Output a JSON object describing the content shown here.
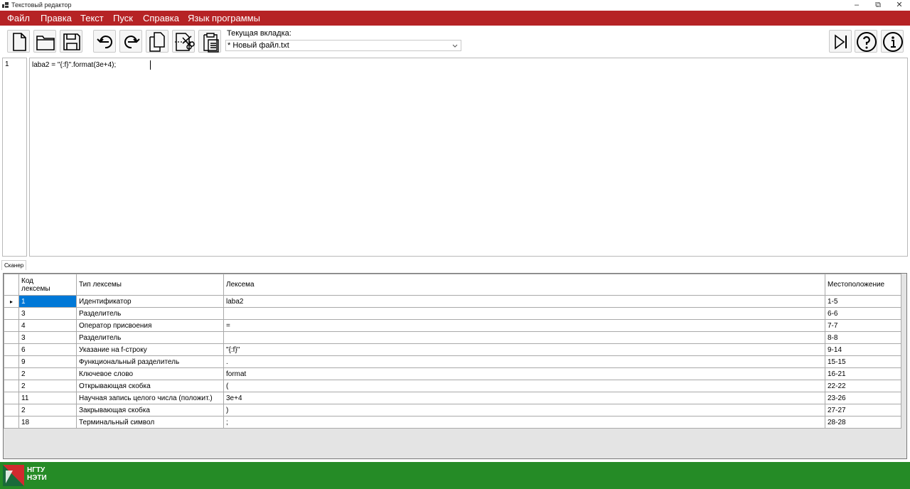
{
  "window": {
    "title": "Текстовый редактор",
    "minimize": "–",
    "restore": "⧉",
    "close": "✕"
  },
  "menu": [
    "Файл",
    "Правка",
    "Текст",
    "Пуск",
    "Справка",
    "Язык программы"
  ],
  "toolbar": {
    "tab_label": "Текущая вкладка:",
    "tab_value": "* Новый файл.txt",
    "buttons": [
      "new-file-icon",
      "open-folder-icon",
      "save-icon",
      "undo-icon",
      "redo-icon",
      "copy-icon",
      "cut-icon",
      "paste-icon",
      "run-icon",
      "help-icon",
      "info-icon"
    ]
  },
  "editor": {
    "line_numbers": "1",
    "code": "laba2 = \"{:f}\".format(3e+4);"
  },
  "scanner": {
    "tab": "Сканер",
    "headers": [
      "Код\nлексемы",
      "Тип лексемы",
      "Лексема",
      "Местоположение"
    ],
    "rows": [
      {
        "code": "1",
        "type": "Идентификатор",
        "lexeme": "laba2",
        "loc": "1-5"
      },
      {
        "code": "3",
        "type": "Разделитель",
        "lexeme": "",
        "loc": "6-6"
      },
      {
        "code": "4",
        "type": "Оператор присвоения",
        "lexeme": "=",
        "loc": "7-7"
      },
      {
        "code": "3",
        "type": "Разделитель",
        "lexeme": "",
        "loc": "8-8"
      },
      {
        "code": "6",
        "type": "Указание на f-строку",
        "lexeme": "\"{:f}\"",
        "loc": "9-14"
      },
      {
        "code": "9",
        "type": "Функциональный разделитель",
        "lexeme": ".",
        "loc": "15-15"
      },
      {
        "code": "2",
        "type": "Ключевое слово",
        "lexeme": "format",
        "loc": "16-21"
      },
      {
        "code": "2",
        "type": "Открывающая скобка",
        "lexeme": "(",
        "loc": "22-22"
      },
      {
        "code": "11",
        "type": "Научная запись целого числа (положит.)",
        "lexeme": "3e+4",
        "loc": "23-26"
      },
      {
        "code": "2",
        "type": "Закрывающая скобка",
        "lexeme": ")",
        "loc": "27-27"
      },
      {
        "code": "18",
        "type": "Терминальный символ",
        "lexeme": ";",
        "loc": "28-28"
      }
    ],
    "selected_row": 0,
    "current_row_marker": "▸"
  },
  "footer": {
    "logo_line1": "НГТУ",
    "logo_line2": "НЭТИ"
  },
  "colors": {
    "menubar": "#b62325",
    "footer": "#258b26",
    "selection": "#0078d7"
  }
}
